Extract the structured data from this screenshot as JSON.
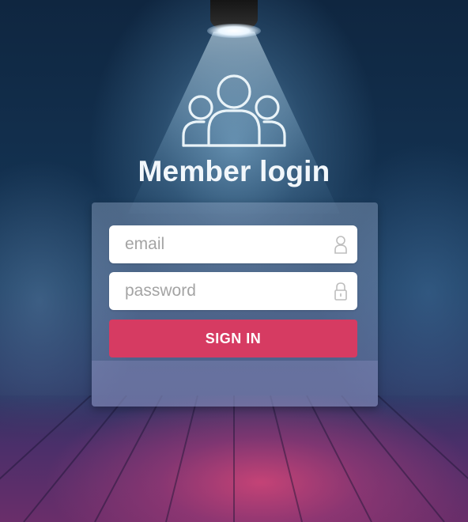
{
  "page": {
    "title": "Member login"
  },
  "form": {
    "email": {
      "value": "",
      "placeholder": "email"
    },
    "password": {
      "value": "",
      "placeholder": "password"
    },
    "submit_label": "SIGN IN"
  },
  "icons": {
    "header": "users-group-icon",
    "email_field": "user-icon",
    "password_field": "lock-icon"
  },
  "colors": {
    "accent": "#d63b62",
    "background": "#133150",
    "title": "#f2f7fb"
  }
}
